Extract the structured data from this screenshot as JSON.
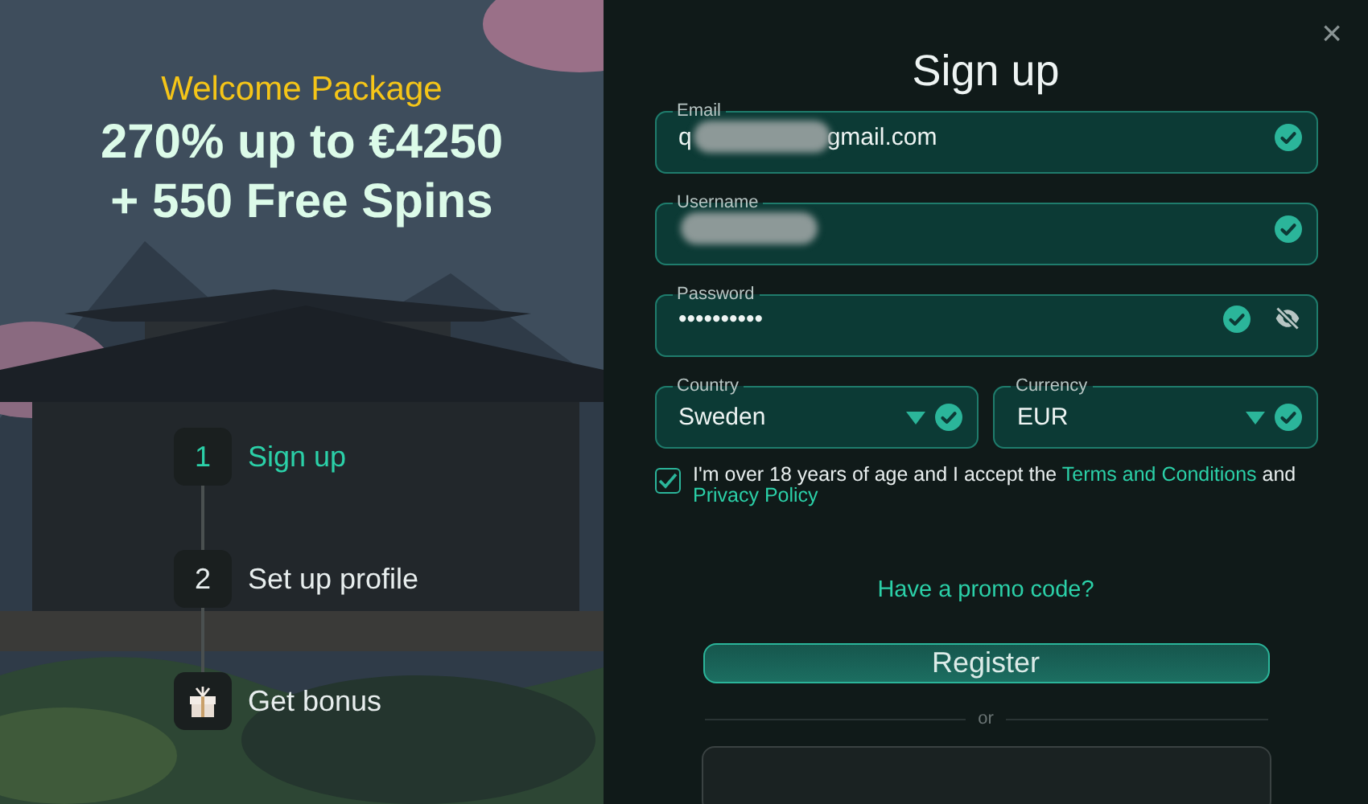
{
  "promo": {
    "welcome": "Welcome Package",
    "headline": "270% up to €4250 + 550 Free Spins"
  },
  "steps": [
    {
      "kind": "number",
      "number": "1",
      "label": "Sign up",
      "selected": true
    },
    {
      "kind": "number",
      "number": "2",
      "label": "Set up profile",
      "selected": false
    },
    {
      "kind": "gift",
      "label": "Get bonus",
      "selected": false
    }
  ],
  "dialog": {
    "close": "×",
    "title": "Sign up",
    "fields": [
      {
        "kind": "text",
        "label": "Email",
        "value": "q",
        "redacted": true,
        "value_after": "gmail.com",
        "valid": true
      },
      {
        "kind": "text",
        "label": "Username",
        "redacted": true,
        "valid": true
      },
      {
        "kind": "password",
        "label": "Password",
        "value": "••••••••••",
        "valid": true,
        "revealed": false
      }
    ],
    "selects": [
      {
        "label": "Country",
        "value": "Sweden",
        "valid": true
      },
      {
        "label": "Currency",
        "value": "EUR",
        "valid": true
      }
    ],
    "consent": {
      "checked": true,
      "text": "I'm over 18 years of age and I accept the ",
      "terms_link": "Terms and Conditions",
      "middle": " and ",
      "privacy_link": "Privacy Policy"
    },
    "promo_link": "Have a promo code?",
    "register": "Register",
    "divider": "or"
  }
}
